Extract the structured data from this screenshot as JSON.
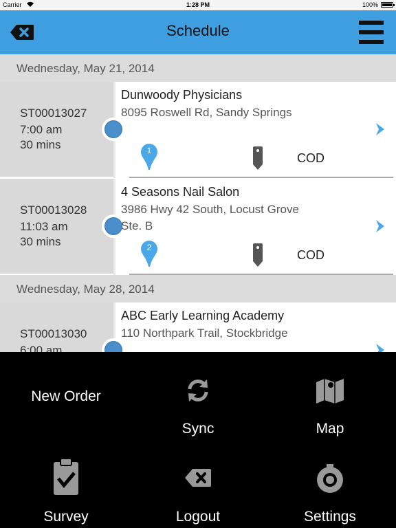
{
  "status_bar": {
    "carrier": "Carrier",
    "time": "1:28 PM",
    "battery": "100%"
  },
  "navbar": {
    "title": "Schedule",
    "back_icon": "delete-back-icon",
    "menu_icon": "hamburger-menu-icon",
    "color": "#3f9ee0"
  },
  "groups": [
    {
      "date": "Wednesday, May 21, 2014",
      "items": [
        {
          "id": "ST00013027",
          "time": "7:00 am",
          "duration": "30 mins",
          "name": "Dunwoody Physicians",
          "address_line1": "8095 Roswell Rd, Sandy Springs",
          "address_line2": "",
          "stop_number": "1",
          "payment": "COD"
        },
        {
          "id": "ST00013028",
          "time": "11:03 am",
          "duration": "30 mins",
          "name": "4 Seasons Nail Salon",
          "address_line1": "3986 Hwy 42 South, Locust Grove",
          "address_line2": "Ste. B",
          "stop_number": "2",
          "payment": "COD"
        }
      ]
    },
    {
      "date": "Wednesday, May 28, 2014",
      "items": [
        {
          "id": "ST00013030",
          "time": "6:00 am",
          "name": "ABC Early Learning Academy",
          "address_line1": "110 Northpark Trail, Stockbridge"
        }
      ]
    }
  ],
  "menu": {
    "new_order": "New Order",
    "sync": "Sync",
    "map": "Map",
    "survey": "Survey",
    "logout": "Logout",
    "settings": "Settings"
  }
}
